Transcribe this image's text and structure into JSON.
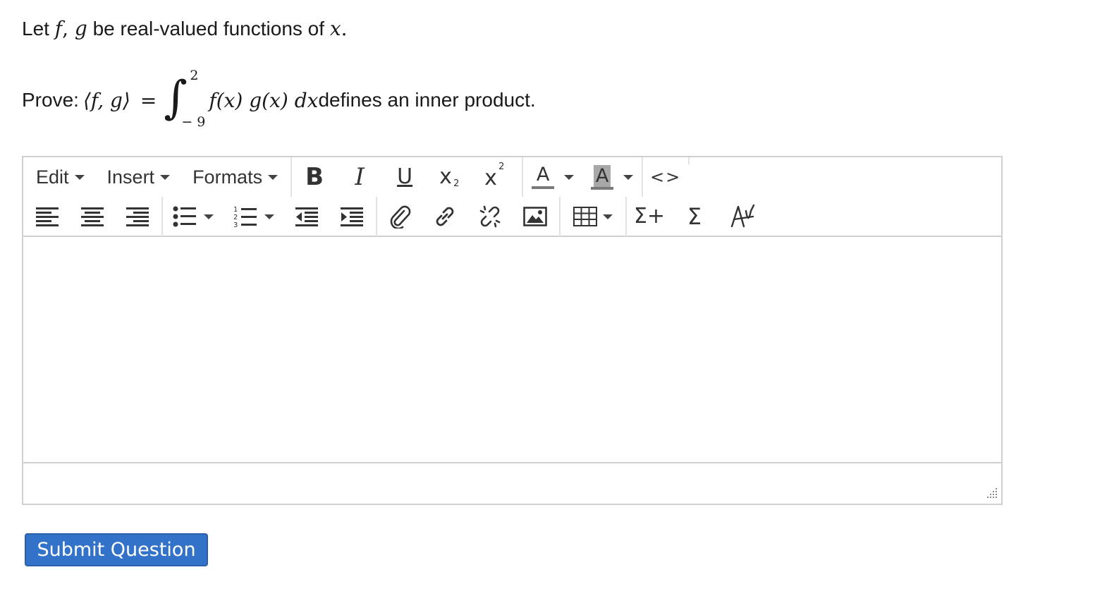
{
  "problem": {
    "line1_prefix": "Let ",
    "line1_f": "f",
    "line1_comma": ", ",
    "line1_g": "g",
    "line1_middle": " be real-valued functions of ",
    "line1_x": "x",
    "line1_end": ".",
    "line2_prefix": "Prove: ",
    "inner_product_lhs": "⟨f, g⟩",
    "equals": "=",
    "integral_symbol": "∫",
    "upper_limit": "2",
    "lower_limit": "− 9",
    "integrand": "f(x) g(x) dx",
    "line2_suffix": " defines an inner product."
  },
  "editor": {
    "menus": {
      "edit": "Edit",
      "insert": "Insert",
      "formats": "Formats"
    },
    "icons": {
      "bold": "B",
      "italic": "I",
      "underline": "U",
      "subscript": "x",
      "subscript_mark": "2",
      "superscript": "x",
      "superscript_mark": "2",
      "text_color": "A",
      "background_color": "A",
      "source_code": "<>",
      "sigma_plus": "Σ+",
      "sigma": "Σ"
    },
    "colors": {
      "text_color_bar": "#7a7a7a",
      "background_color_fill": "#a8a8a8"
    },
    "content": ""
  },
  "submit": {
    "label": "Submit Question",
    "color": "#3272c9"
  }
}
